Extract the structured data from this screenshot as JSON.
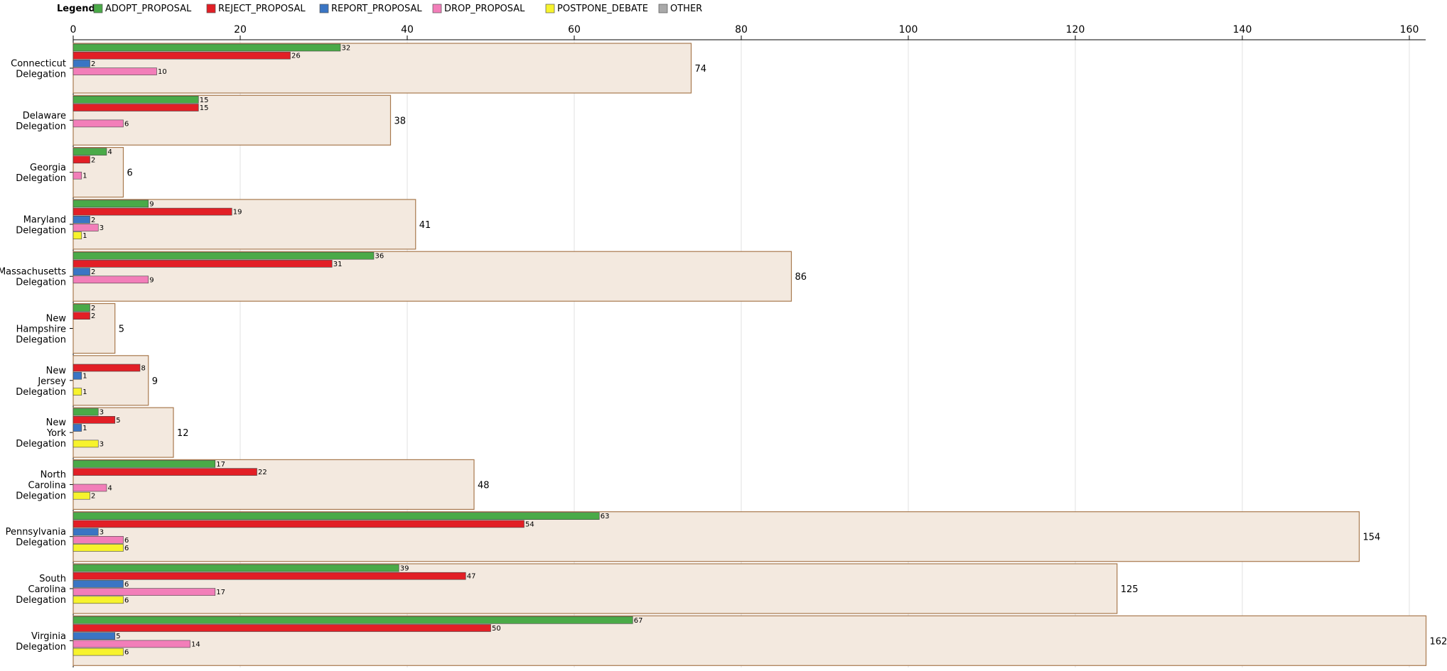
{
  "chart_data": {
    "type": "bar",
    "orientation": "horizontal",
    "legend_title": "Legend:",
    "legend_position": "top-left",
    "grid": true,
    "xlim": [
      0,
      162
    ],
    "x_ticks": [
      0,
      20,
      40,
      60,
      80,
      100,
      120,
      140,
      160
    ],
    "categories": [
      [
        "Connecticut",
        "Delegation"
      ],
      [
        "Delaware",
        "Delegation"
      ],
      [
        "Georgia",
        "Delegation"
      ],
      [
        "Maryland",
        "Delegation"
      ],
      [
        "Massachusetts",
        "Delegation"
      ],
      [
        "New",
        "Hampshire",
        "Delegation"
      ],
      [
        "New",
        "Jersey",
        "Delegation"
      ],
      [
        "New",
        "York",
        "Delegation"
      ],
      [
        "North",
        "Carolina",
        "Delegation"
      ],
      [
        "Pennsylvania",
        "Delegation"
      ],
      [
        "South",
        "Carolina",
        "Delegation"
      ],
      [
        "Virginia",
        "Delegation"
      ]
    ],
    "totals": [
      74,
      38,
      6,
      41,
      86,
      5,
      9,
      12,
      48,
      154,
      125,
      162
    ],
    "series": [
      {
        "name": "ADOPT_PROPOSAL",
        "color": "#4aaa48",
        "values": [
          32,
          15,
          4,
          9,
          36,
          2,
          0,
          3,
          17,
          63,
          39,
          67
        ]
      },
      {
        "name": "REJECT_PROPOSAL",
        "color": "#e21f26",
        "values": [
          26,
          15,
          2,
          19,
          31,
          2,
          8,
          5,
          22,
          54,
          47,
          50
        ]
      },
      {
        "name": "REPORT_PROPOSAL",
        "color": "#3a75c4",
        "values": [
          2,
          0,
          0,
          2,
          2,
          0,
          1,
          1,
          0,
          3,
          6,
          5
        ]
      },
      {
        "name": "DROP_PROPOSAL",
        "color": "#f27eb9",
        "values": [
          10,
          6,
          1,
          3,
          9,
          0,
          0,
          0,
          4,
          6,
          17,
          14
        ]
      },
      {
        "name": "POSTPONE_DEBATE",
        "color": "#f7f32d",
        "values": [
          0,
          0,
          0,
          1,
          0,
          0,
          1,
          3,
          2,
          6,
          6,
          6
        ]
      },
      {
        "name": "OTHER",
        "color": "#a9a9a9",
        "values": [
          0,
          0,
          0,
          0,
          0,
          0,
          0,
          0,
          0,
          0,
          0,
          0
        ]
      }
    ],
    "total_bar_fill": "#f3e9df",
    "total_bar_stroke": "#a8794e"
  }
}
